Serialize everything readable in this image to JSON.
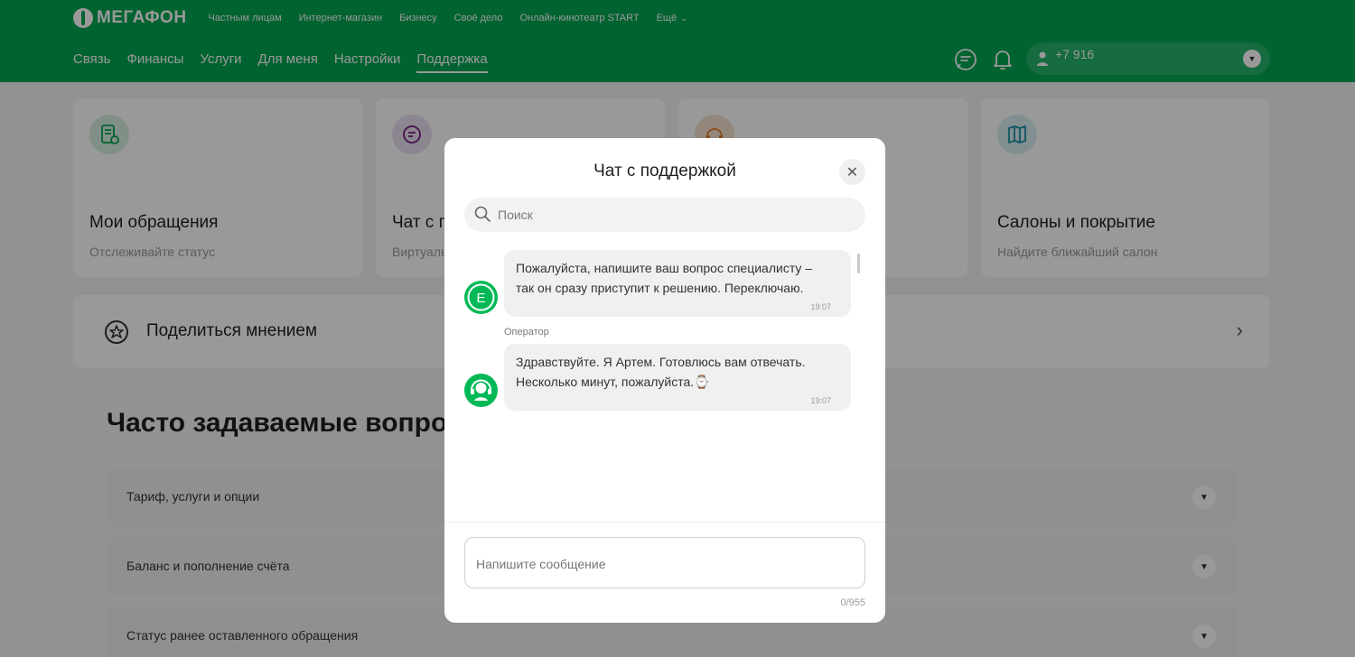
{
  "header": {
    "logo_text": "МЕГАФОН",
    "top_nav": [
      "Частным лицам",
      "Интернет-магазин",
      "Бизнесу",
      "Своё дело",
      "Онлайн-кинотеатр START"
    ],
    "more_label": "Ещё",
    "main_nav": [
      {
        "label": "Связь",
        "active": false
      },
      {
        "label": "Финансы",
        "active": false
      },
      {
        "label": "Услуги",
        "active": false
      },
      {
        "label": "Для меня",
        "active": false
      },
      {
        "label": "Настройки",
        "active": false
      },
      {
        "label": "Поддержка",
        "active": true
      }
    ],
    "phone": "+7 916",
    "icons": {
      "chat": "chat-bubble-icon",
      "notifications": "bell-icon",
      "user": "user-icon",
      "dropdown": "chevron-down-icon"
    }
  },
  "cards": [
    {
      "title": "Мои обращения",
      "subtitle": "Отслеживайте статус",
      "icon": "document-check-icon",
      "color": "#d8f0e2"
    },
    {
      "title": "Чат с поддержкой",
      "subtitle": "Виртуальный помощник",
      "icon": "chat-icon",
      "color": "#eadff0"
    },
    {
      "title": "",
      "subtitle": "",
      "icon": "headset-icon",
      "color": "#f5e2cf"
    },
    {
      "title": "Салоны и покрытие",
      "subtitle": "Найдите ближайший салон",
      "icon": "map-icon",
      "color": "#d9eef2"
    }
  ],
  "share": {
    "label": "Поделиться мнением",
    "icon": "star-chat-icon"
  },
  "faq": {
    "title": "Часто задаваемые вопросы",
    "items": [
      "Тариф, услуги и опции",
      "Баланс и пополнение счёта",
      "Статус ранее оставленного обращения"
    ]
  },
  "chat_modal": {
    "title": "Чат с поддержкой",
    "search_placeholder": "Поиск",
    "messages": [
      {
        "sender": "",
        "avatar": "bot-e-icon",
        "text": "Пожалуйста, напишите ваш вопрос специалисту – так он сразу приступит к решению. Переключаю.",
        "time": "19:07"
      },
      {
        "sender": "Оператор",
        "avatar": "operator-headset-icon",
        "text": "Здравствуйте. Я Артем. Готовлюсь вам отвечать. Несколько минут, пожалуйста.⌚",
        "time": "19:07"
      }
    ],
    "input_placeholder": "Напишите сообщение",
    "counter": "0/955"
  },
  "colors": {
    "brand": "#00a650",
    "accent": "#00b956",
    "overlay": "rgba(0,0,0,0.4)"
  }
}
